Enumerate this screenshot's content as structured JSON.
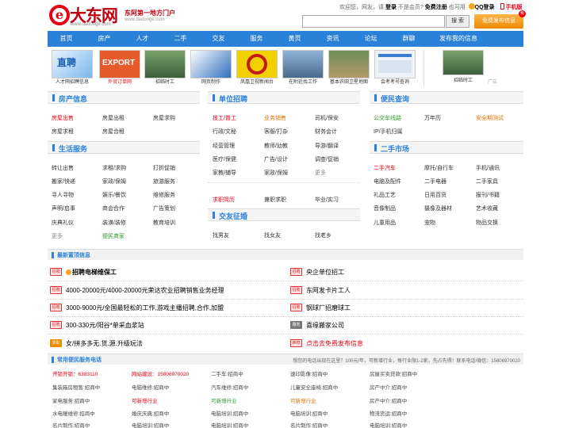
{
  "header": {
    "logo_letter": "e",
    "logo_text": "大东网",
    "logo_url": "www.dadonge.com",
    "slogan": "东阿第一地方门户",
    "slogan_url": "www.dadonge.com",
    "greeting": "欢迎您，网友，请",
    "login": "登录",
    "not_member": "不是会员?",
    "register": "免费注册",
    "also": "也可用",
    "qq_login": "QQ登录",
    "mobile": "手机版",
    "search_placeholder": "",
    "search_button": "搜 索",
    "post_button": "免费发布信息",
    "post_badge": "免"
  },
  "nav": [
    "首页",
    "房产",
    "人才",
    "二手",
    "交友",
    "服务",
    "黄页",
    "资讯",
    "论坛",
    "群聊",
    "发布我的信息"
  ],
  "strip": [
    {
      "caption": "人才网招聘信息",
      "red": false
    },
    {
      "caption": "外贸订单网",
      "red": true
    },
    {
      "caption": "招临时工",
      "red": false
    },
    {
      "caption": "网页制作",
      "red": false
    },
    {
      "caption": "凤凰卫视新闻台",
      "red": false
    },
    {
      "caption": "在附近找工作",
      "red": false
    },
    {
      "caption": "基本农田卫星地图",
      "red": false
    },
    {
      "caption": "会考考号查询",
      "red": false
    },
    {
      "caption": "招临时工",
      "red": false
    }
  ],
  "strip_ad_label": "广告",
  "house": {
    "title": "房产信息",
    "items": [
      "房屋出售",
      "房屋出租",
      "房屋求购",
      "房屋求租",
      "房屋合租"
    ]
  },
  "life": {
    "title": "生活服务",
    "items": [
      "转让出售",
      "求租/求购",
      "打折促销",
      "搬家/快递",
      "家政/保姆",
      "旅游服务",
      "寻人寻物",
      "娱乐/餐饮",
      "维修服务",
      "声明/启事",
      "商会合作",
      "广告策划",
      "庆典礼仪",
      "装潢/装修",
      "教育培训",
      "更多",
      "便民商家"
    ]
  },
  "jobs": {
    "title": "单位招聘",
    "items": [
      "技工/普工",
      "业务销售",
      "司机/保安",
      "行政/文秘",
      "客服/打杂",
      "财务会计",
      "经营管理",
      "教师/幼教",
      "导游/翻译",
      "医疗/保健",
      "广告/设计",
      "调查/促销",
      "家教/辅导",
      "家政/保姆",
      "更多"
    ],
    "extra": [
      "求职简历",
      "兼职求职",
      "毕业/实习"
    ]
  },
  "dating": {
    "title": "交友征婚",
    "items": [
      "找男友",
      "找女友",
      "找老乡"
    ]
  },
  "convenience": {
    "title": "便民查询",
    "items": [
      "公交车线路",
      "万年历",
      "安全期测试",
      "IP/手机归属"
    ]
  },
  "secondhand": {
    "title": "二手市场",
    "items": [
      "二手汽车",
      "摩托/自行车",
      "手机/通讯",
      "电脑及配件",
      "二手电器",
      "二手家具",
      "礼品工艺",
      "日用百货",
      "报刊/书籍",
      "音像制品",
      "摄像及器材",
      "艺术收藏",
      "儿童用品",
      "宠物",
      "物品交换"
    ]
  },
  "latest": {
    "title": "最新置顶信息",
    "rows": [
      {
        "left_tag": "招聘",
        "left": "招聘电梯维保工",
        "right_tag": "招聘",
        "right": "央企单位招工"
      },
      {
        "left_tag": "招聘",
        "left": "4000-20000元/4000-20000元荣达农业招聘销售业务经理",
        "right_tag": "招聘",
        "right": "东阿发卡片工人"
      },
      {
        "left_tag": "招聘",
        "left": "3000-9000元/全国最轻松的工作,游戏主播招聘,合作,加盟",
        "right_tag": "招聘",
        "right": "钢球厂招磨球工"
      },
      {
        "left_tag": "招聘",
        "left": "300-330元/阳谷*单采血浆站",
        "right_tag": "服务",
        "right": "喜缘搬家公司"
      },
      {
        "left_tag": "求职",
        "left": "女/拼多多无.货.源.升级玩法",
        "right_tag": "推荐",
        "right": "点击去免费发布信息"
      }
    ]
  },
  "phones": {
    "title": "常用便民服务电话",
    "note": "想您的电话出现在这里？100元/年，可新增行业，每行业限1-2家，先占先得！联系电话/微信：15806970020",
    "rows": [
      [
        "开锁开锁：6383110",
        "网站建设：15806970020",
        "二手车:招商中",
        "速印影像:招商中",
        "房屋买卖贷款:招商中"
      ],
      [
        "集装箱房租售:招商中",
        "电脑维修:招商中",
        "汽车维修:招商中",
        "儿童安全座椅:招商中",
        "房产中介:招商中"
      ],
      [
        "家电服务:招商中",
        "可新增行业",
        "可新增行业",
        "可新增行业",
        "房产中介:招商中"
      ],
      [
        "水电暖维修:招商中",
        "婚庆庆典:招商中",
        "电脑培训:招商中",
        "电脑培训:招商中",
        "物流货运:招商中"
      ],
      [
        "名片制作:招商中",
        "电脑培训:招商中",
        "电脑培训:招商中",
        "名片制作:招商中",
        "电脑培训:招商中"
      ]
    ]
  }
}
